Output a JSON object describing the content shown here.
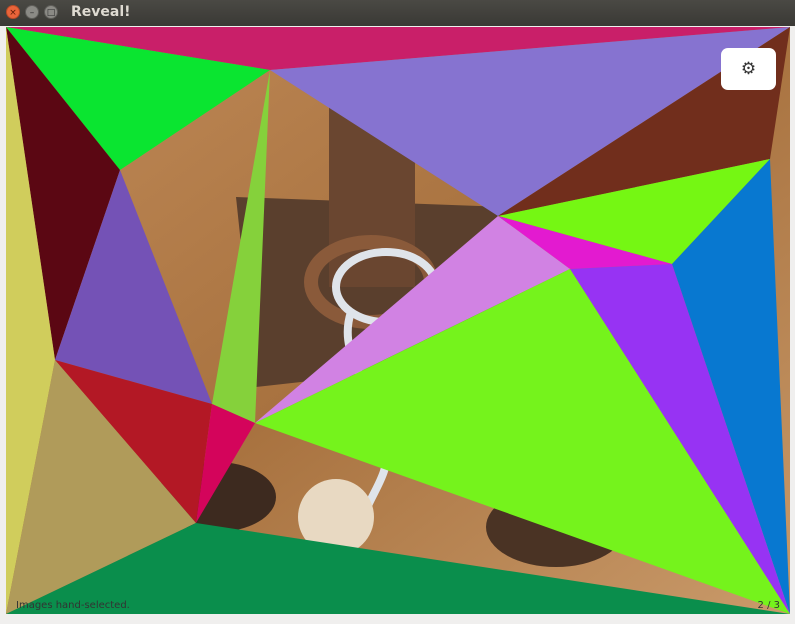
{
  "window": {
    "title": "Reveal!"
  },
  "controls": {
    "close_glyph": "×",
    "minimize_glyph": "–",
    "maximize_glyph": "□",
    "settings_glyph": "⚙",
    "settings_icon": "gear-icon"
  },
  "footer": {
    "credit": "Images hand-selected.",
    "counter": "2 / 3"
  }
}
